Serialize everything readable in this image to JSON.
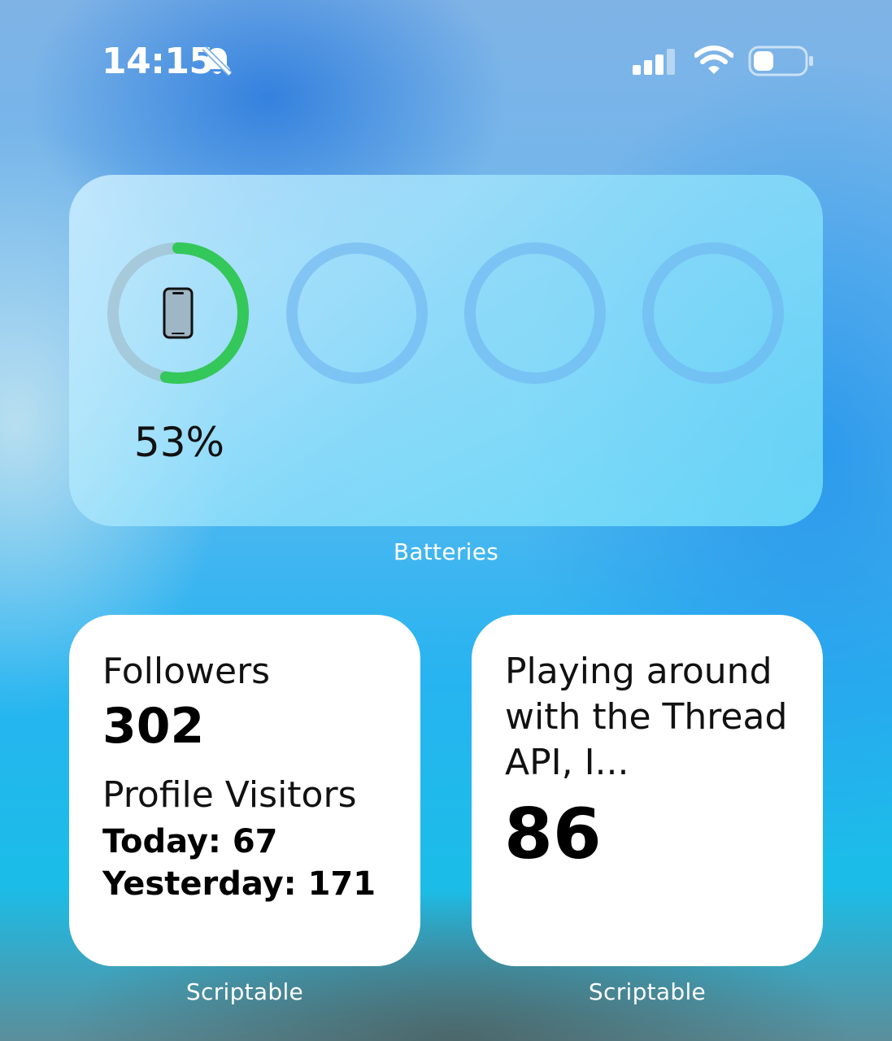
{
  "status_bar": {
    "time": "14:15",
    "icons": [
      "bell-slash-icon",
      "cellular-signal-icon",
      "wifi-icon",
      "battery-icon"
    ],
    "signal_bars_active": 3,
    "phone_battery_level": 0.4
  },
  "batteries_widget": {
    "caption": "Batteries",
    "device_icon": "iphone-icon",
    "percent_text": "53%",
    "percent_value": 0.53,
    "ring_color": "#34c759",
    "empty_slots": 3
  },
  "followers_widget": {
    "caption": "Scriptable",
    "followers_label": "Followers",
    "followers_value": "302",
    "visitors_label": "Profile Visitors",
    "today": "Today: 67",
    "yesterday": "Yesterday: 171"
  },
  "post_widget": {
    "caption": "Scriptable",
    "post_title": "Playing around with the Thread API, I...",
    "post_value": "86"
  }
}
